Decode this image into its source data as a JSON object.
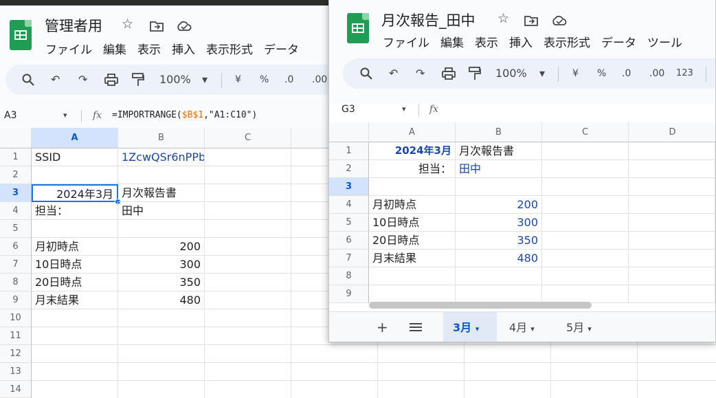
{
  "left_window": {
    "title": "管理者用",
    "menu": [
      "ファイル",
      "編集",
      "表示",
      "挿入",
      "表示形式",
      "データ"
    ],
    "toolbar": {
      "zoom": "100%",
      "currency": "¥",
      "percent": "%",
      "dec_dec": ".0",
      "inc_dec": ".00"
    },
    "name_box": "A3",
    "formula_prefix": "=IMPORTRANGE(",
    "formula_ref": "$B$1",
    "formula_rest": ",\"A1:C10\")",
    "columns": [
      "A",
      "B",
      "C"
    ],
    "rows": [
      "1",
      "2",
      "3",
      "4",
      "5",
      "6",
      "7",
      "8",
      "9",
      "10",
      "11",
      "12",
      "13",
      "14"
    ],
    "cells": {
      "a1": "SSID",
      "b1": "1ZcwQSr6nPPb",
      "a3": "2024年3月",
      "b3": "月次報告書",
      "a4": "担当：",
      "b4": "田中",
      "a6": "月初時点",
      "b6": "200",
      "a7": "10日時点",
      "b7": "300",
      "a8": "20日時点",
      "b8": "350",
      "a9": "月末結果",
      "b9": "480"
    }
  },
  "right_window": {
    "title": "月次報告_田中",
    "menu": [
      "ファイル",
      "編集",
      "表示",
      "挿入",
      "表示形式",
      "データ",
      "ツール"
    ],
    "toolbar": {
      "zoom": "100%",
      "currency": "¥",
      "percent": "%",
      "dec_dec": ".0",
      "inc_dec": ".00",
      "format_num": "123"
    },
    "name_box": "G3",
    "columns": [
      "A",
      "B",
      "C",
      "D"
    ],
    "rows": [
      "1",
      "2",
      "3",
      "4",
      "5",
      "6",
      "7",
      "8",
      "9"
    ],
    "cells": {
      "a1": "2024年3月",
      "b1": "月次報告書",
      "a2": "担当：",
      "b2": "田中",
      "a4": "月初時点",
      "b4": "200",
      "a5": "10日時点",
      "b5": "300",
      "a6": "20日時点",
      "b6": "350",
      "a7": "月末結果",
      "b7": "480"
    },
    "sheet_tabs": [
      "3月",
      "4月",
      "5月"
    ],
    "add_sheet": "+",
    "all_sheets": "≡"
  },
  "icons": {
    "star": "☆",
    "search": "🔍",
    "undo": "↶",
    "redo": "↷",
    "dropdown": "▾",
    "fx": "fx"
  }
}
